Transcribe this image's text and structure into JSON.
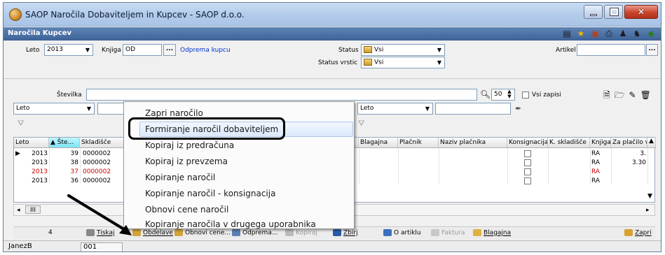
{
  "window": {
    "title": "SAOP  Naročila Dobaviteljem in Kupcev - SAOP d.o.o."
  },
  "subheader": {
    "title": "Naročila Kupcev"
  },
  "filters": {
    "leto_label": "Leto",
    "leto_value": "2013",
    "knjiga_label": "Knjiga",
    "knjiga_value": "OD",
    "ellipsis": "...",
    "odprema_link": "Odprema kupcu",
    "status_label": "Status",
    "status_value": "Vsi",
    "status_vrstic_label": "Status vrstic",
    "status_vrstic_value": "Vsi",
    "artikel_label": "Artikel"
  },
  "search": {
    "stevilka_label": "Številka",
    "count_value": "50",
    "vsi_zapisi_label": "Vsi zapisi"
  },
  "filter_row": {
    "leto1": "Leto",
    "leto2": "Leto"
  },
  "grid": {
    "columns": [
      "Leto",
      "Šte...",
      "Skladišče",
      "Blagajna",
      "Plačnik",
      "Naziv plačnika",
      "Konsignacija",
      "K. skladišče",
      "Knjiga",
      "Za plačilo v TE"
    ],
    "rows": [
      {
        "leto": "2013",
        "st": "39",
        "skladisce": "0000002",
        "knjiga": "RA",
        "za_placilo": "3.",
        "red": false
      },
      {
        "leto": "2013",
        "st": "38",
        "skladisce": "0000002",
        "knjiga": "RA",
        "za_placilo": "3.30",
        "red": false
      },
      {
        "leto": "2013",
        "st": "37",
        "skladisce": "0000002",
        "knjiga": "RA",
        "za_placilo": "",
        "red": true
      },
      {
        "leto": "2013",
        "st": "36",
        "skladisce": "0000002",
        "knjiga": "RA",
        "za_placilo": "",
        "red": false
      }
    ],
    "scroll_thumb": "III"
  },
  "bottom": {
    "count": "4",
    "tiskaj": "Tiskaj",
    "obdelave": "Obdelave",
    "obnovi_cene": "Obnovi cene...",
    "odprema": "Odprema...",
    "kopiraj": "Kopiraj",
    "zbirj": "Zbirj",
    "o_artiklu": "O artiklu",
    "faktura": "Faktura",
    "blagajna": "Blagajna",
    "zapri": "Zapri"
  },
  "status": {
    "user": "JanezB",
    "code": "001"
  },
  "context_menu": {
    "items": [
      "Zapri naročilo",
      "Formiranje naročil dobaviteljem",
      "Kopiraj iz predračuna",
      "Kopiraj iz prevzema",
      "Kopiranje naročil",
      "Kopiranje naročil - konsignacija",
      "Obnovi cene naročil",
      "Kopiranje naročila v drugega uporabnika"
    ]
  }
}
